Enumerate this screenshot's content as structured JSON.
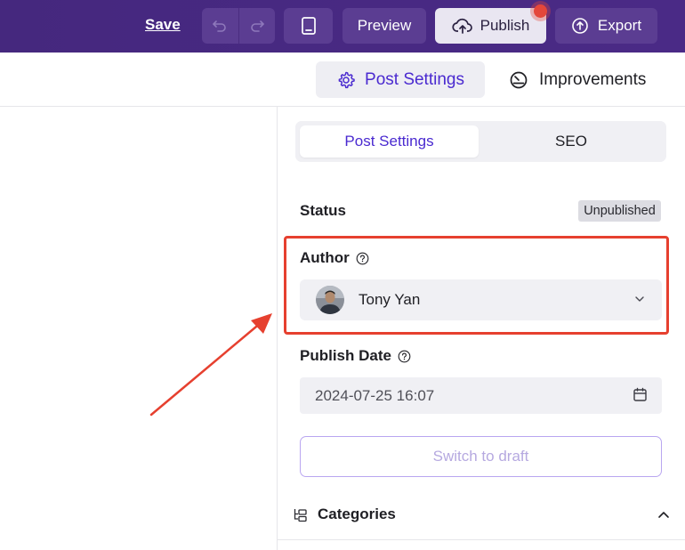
{
  "toolbar": {
    "save_label": "Save",
    "preview_label": "Preview",
    "publish_label": "Publish",
    "export_label": "Export"
  },
  "subnav": {
    "post_settings_label": "Post Settings",
    "improvements_label": "Improvements"
  },
  "panel": {
    "tabs": [
      {
        "label": "Post Settings",
        "active": true
      },
      {
        "label": "SEO",
        "active": false
      }
    ],
    "status": {
      "label": "Status",
      "badge": "Unpublished"
    },
    "author": {
      "label": "Author",
      "name": "Tony Yan"
    },
    "publish_date": {
      "label": "Publish Date",
      "value": "2024-07-25 16:07"
    },
    "switch_draft_label": "Switch to draft",
    "categories_label": "Categories"
  },
  "colors": {
    "topbar": "#45287e",
    "accent": "#4a2ad0",
    "highlight": "#e6402f",
    "publish_dot": "#e4473a"
  },
  "icons": [
    "undo-icon",
    "redo-icon",
    "tablet-icon",
    "cloud-upload-icon",
    "upload-icon",
    "gear-icon",
    "gauge-icon",
    "help-icon",
    "chevron-down-icon",
    "calendar-icon",
    "tree-icon",
    "chevron-up-icon"
  ]
}
